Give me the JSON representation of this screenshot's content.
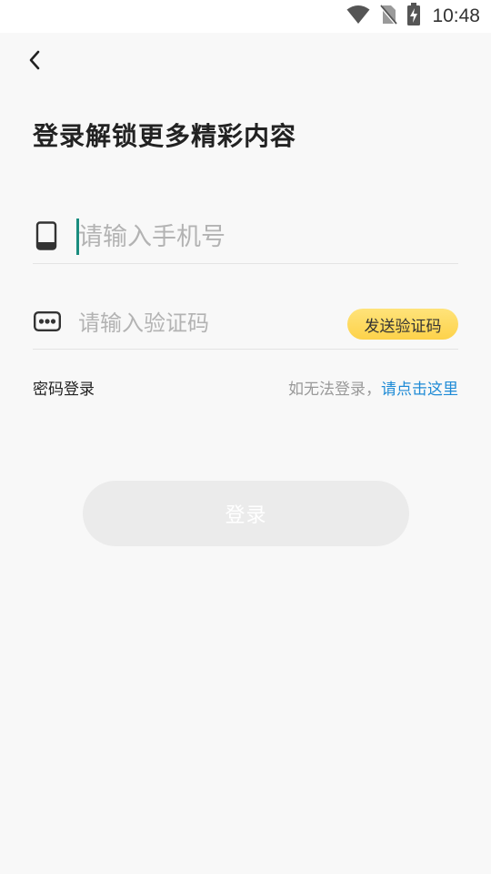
{
  "status_bar": {
    "time": "10:48",
    "icons": [
      "wifi-icon",
      "no-sim-icon",
      "battery-charging-icon"
    ]
  },
  "header": {
    "back_icon": "chevron-left-icon"
  },
  "page": {
    "title": "登录解锁更多精彩内容"
  },
  "form": {
    "phone": {
      "icon": "phone-icon",
      "placeholder": "请输入手机号",
      "value": ""
    },
    "code": {
      "icon": "password-dots-icon",
      "placeholder": "请输入验证码",
      "value": "",
      "send_label": "发送验证码"
    }
  },
  "links": {
    "password_login": "密码登录",
    "help_prefix": "如无法登录，",
    "help_link": "请点击这里"
  },
  "actions": {
    "login_label": "登录"
  },
  "colors": {
    "accent_yellow": "#fdd24a",
    "link_blue": "#1f8bd6",
    "caret_green": "#1a8d7f",
    "disabled_button": "#ebebeb"
  }
}
